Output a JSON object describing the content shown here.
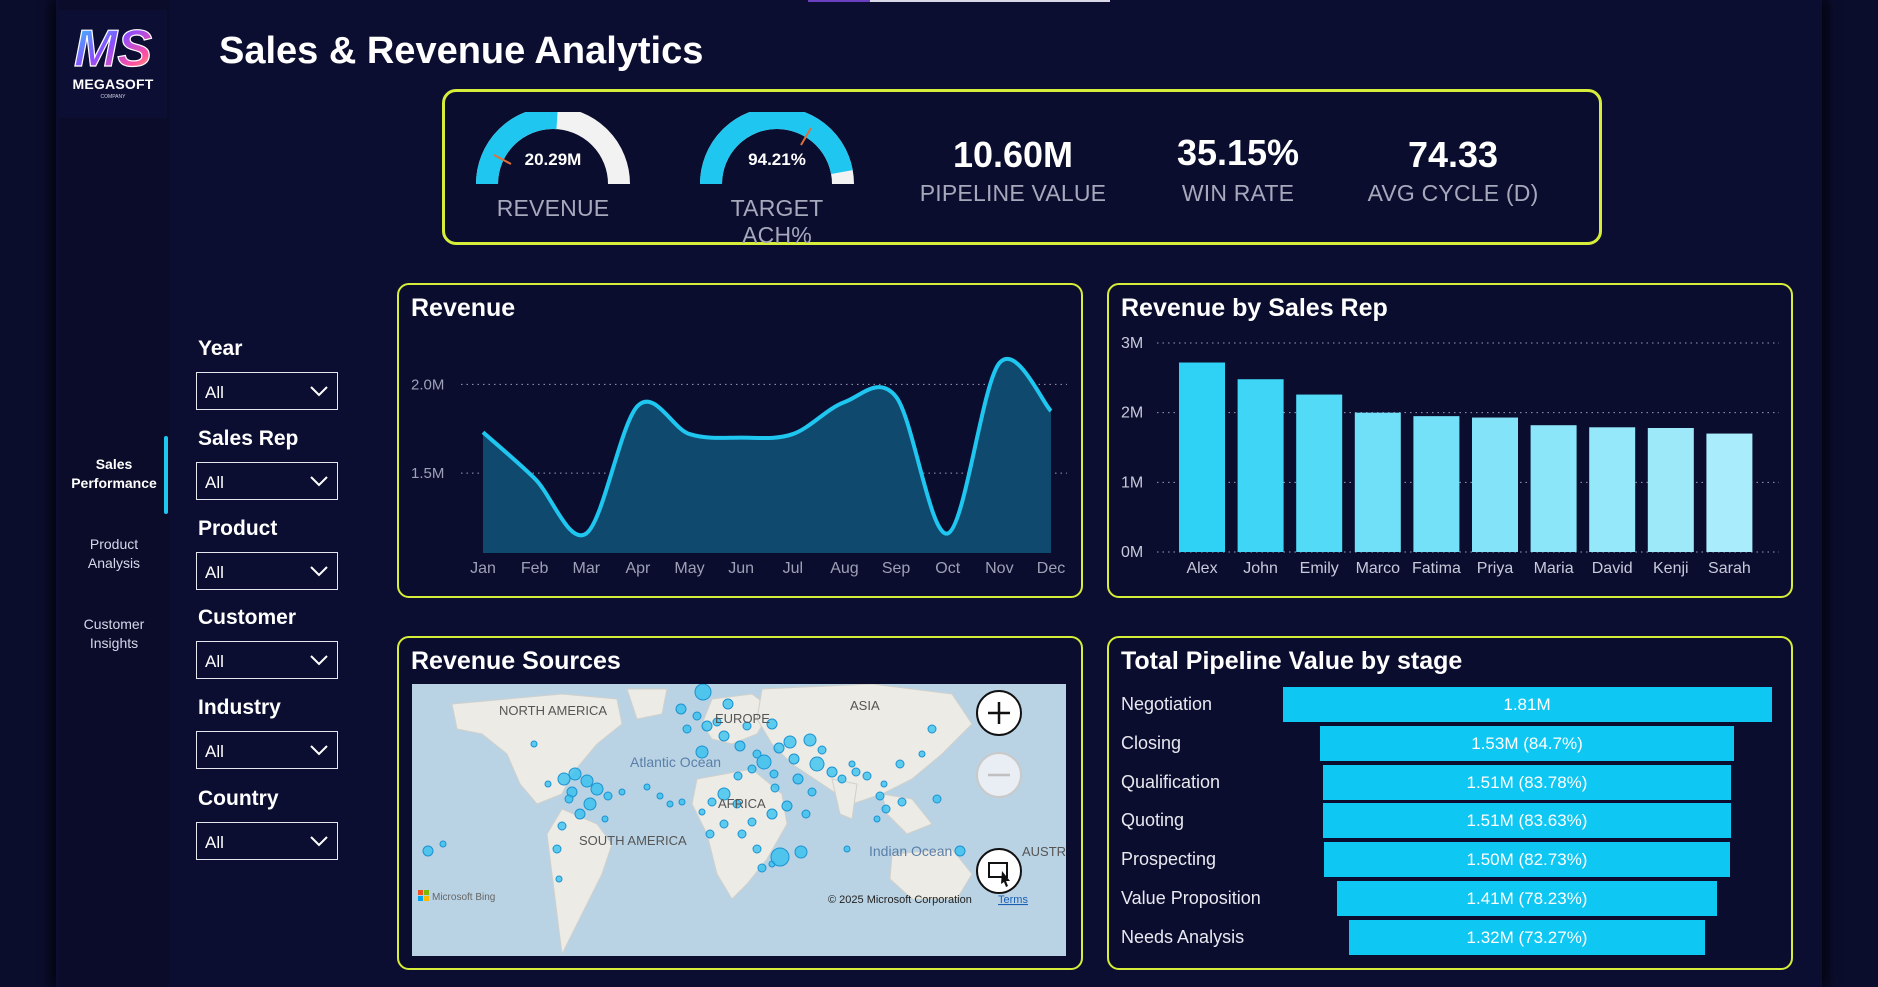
{
  "app": {
    "title": "Sales & Revenue Analytics"
  },
  "logo": {
    "text": "MEGASOFT",
    "sub": "COMPANY",
    "mark": "MS"
  },
  "nav": [
    {
      "label_line1": "Sales",
      "label_line2": "Performance",
      "active": true
    },
    {
      "label_line1": "Product",
      "label_line2": "Analysis",
      "active": false
    },
    {
      "label_line1": "Customer",
      "label_line2": "Insights",
      "active": false
    }
  ],
  "filters": [
    {
      "label": "Year",
      "value": "All"
    },
    {
      "label": "Sales Rep",
      "value": "All"
    },
    {
      "label": "Product",
      "value": "All"
    },
    {
      "label": "Customer",
      "value": "All"
    },
    {
      "label": "Industry",
      "value": "All"
    },
    {
      "label": "Country",
      "value": "All"
    }
  ],
  "kpis": {
    "revenue": {
      "value": "20.29M",
      "label": "REVENUE",
      "fill": 0.52
    },
    "target": {
      "value": "94.21%",
      "label": "TARGET ACH%",
      "fill": 0.9421
    },
    "pipeline": {
      "value": "10.60M",
      "label": "PIPELINE VALUE"
    },
    "win_rate": {
      "value": "35.15%",
      "label": "WIN RATE"
    },
    "cycle": {
      "value": "74.33",
      "label": "AVG CYCLE (D)"
    }
  },
  "colors": {
    "accent": "#d6ee3a",
    "cyan": "#1fc6f0",
    "area": "#0f4a6e",
    "bar": "#3fd3f5",
    "funnel": "#0fc7f3"
  },
  "revenue_chart": {
    "title": "Revenue",
    "chart_data": {
      "type": "area",
      "categories": [
        "Jan",
        "Feb",
        "Mar",
        "Apr",
        "May",
        "Jun",
        "Jul",
        "Aug",
        "Sep",
        "Oct",
        "Nov",
        "Dec"
      ],
      "values": [
        1.73,
        1.47,
        1.16,
        1.88,
        1.72,
        1.7,
        1.72,
        1.9,
        1.93,
        1.16,
        2.12,
        1.85
      ],
      "ylim": [
        1.05,
        2.25
      ],
      "yticks": [
        {
          "v": 1.5,
          "label": "1.5M"
        },
        {
          "v": 2.0,
          "label": "2.0M"
        }
      ],
      "grid": true
    }
  },
  "rep_chart": {
    "title": "Revenue by Sales Rep",
    "chart_data": {
      "type": "bar",
      "categories": [
        "Alex",
        "John",
        "Emily",
        "Marco",
        "Fatima",
        "Priya",
        "Maria",
        "David",
        "Kenji",
        "Sarah"
      ],
      "values": [
        2.72,
        2.48,
        2.26,
        2.0,
        1.95,
        1.93,
        1.82,
        1.79,
        1.78,
        1.7
      ],
      "ylim": [
        0,
        3
      ],
      "yticks": [
        {
          "v": 0,
          "label": "0M"
        },
        {
          "v": 1,
          "label": "1M"
        },
        {
          "v": 2,
          "label": "2M"
        },
        {
          "v": 3,
          "label": "3M"
        }
      ],
      "grid": true
    }
  },
  "map_panel": {
    "title": "Revenue Sources",
    "labels": {
      "na": "NORTH AMERICA",
      "sa": "SOUTH AMERICA",
      "eu": "EUROPE",
      "af": "AFRICA",
      "as": "ASIA",
      "au": "AUSTRAL",
      "atl": "Atlantic Ocean",
      "ind": "Indian Ocean"
    },
    "attribution": "© 2025 Microsoft Corporation",
    "terms": "Terms",
    "bing": "Microsoft Bing"
  },
  "funnel": {
    "title": "Total Pipeline Value by stage",
    "chart_data": {
      "type": "bar",
      "orientation": "funnel",
      "categories": [
        "Negotiation",
        "Closing",
        "Qualification",
        "Quoting",
        "Prospecting",
        "Value Proposition",
        "Needs Analysis"
      ],
      "values": [
        1.81,
        1.53,
        1.51,
        1.51,
        1.5,
        1.41,
        1.32
      ],
      "labels": [
        "1.81M",
        "1.53M (84.7%)",
        "1.51M (83.78%)",
        "1.51M (83.63%)",
        "1.50M (82.73%)",
        "1.41M (78.23%)",
        "1.32M (73.27%)"
      ]
    }
  }
}
